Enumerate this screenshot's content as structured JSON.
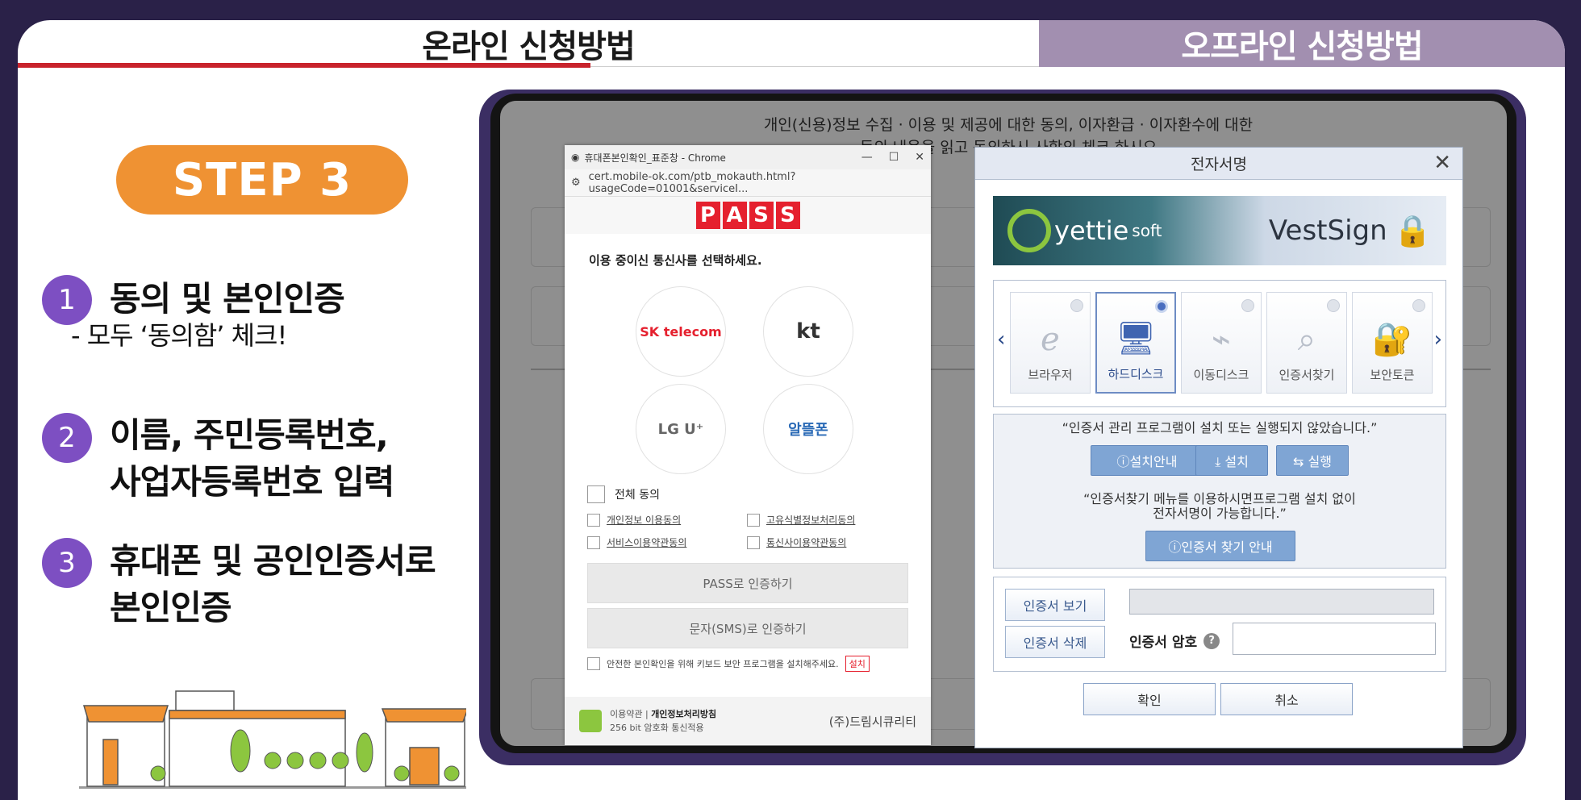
{
  "tabs": {
    "online": "온라인 신청방법",
    "offline": "오프라인 신청방법"
  },
  "step": {
    "label": "STEP 3"
  },
  "items": [
    {
      "num": "1",
      "title_line1": "동의 및 본인인증",
      "sub": "- 모두 ‘동의함’ 체크!"
    },
    {
      "num": "2",
      "title_line1": "이름, 주민등록번호,",
      "title_line2": "사업자등록번호 입력"
    },
    {
      "num": "3",
      "title_line1": "휴대폰 및 공인인증서로",
      "title_line2": "본인인증"
    }
  ],
  "background_page": {
    "line1": "개인(신용)정보 수집 · 이용 및 제공에 대한 동의, 이자환급 · 이자환수에 대한",
    "line2": "동의 내용을 읽고 동의하시 사항의 체크 하시오"
  },
  "pass_window": {
    "window_title": "휴대폰본인확인_표준창 - Chrome",
    "url": "cert.mobile-ok.com/ptb_mokauth.html?usageCode=01001&serviceI...",
    "logo_letters": [
      "P",
      "A",
      "S",
      "S"
    ],
    "prompt": "이용 중이신 통신사를 선택하세요.",
    "carriers": [
      "SK telecom",
      "kt",
      "LG U⁺",
      "알뜰폰"
    ],
    "agree_all": "전체 동의",
    "agreements": [
      "개인정보 이용동의",
      "고유식별정보처리동의",
      "서비스이용약관동의",
      "통신사이용약관동의"
    ],
    "btn_pass": "PASS로 인증하기",
    "btn_sms": "문자(SMS)로 인증하기",
    "security_note": "안전한 본인확인을 위해 키보드 보안 프로그램을 설치해주세요.",
    "install": "설치",
    "footer_terms": "이용약관",
    "footer_privacy": "개인정보처리방침",
    "footer_ssl": "256 bit 암호화 통신적용",
    "company": "(주)드림시큐리티"
  },
  "vest_dialog": {
    "title": "전자서명",
    "brand_left": "yettie",
    "brand_left_sub": "soft",
    "brand_right": "VestSign",
    "media": [
      "브라우저",
      "하드디스크",
      "이동디스크",
      "인증서찾기",
      "보안토큰"
    ],
    "notice1": "“인증서 관리 프로그램이 설치 또는 실행되지 않았습니다.”",
    "btn_install_guide": "ⓘ설치안내",
    "btn_install": "⤓ 설치",
    "btn_run": "⇆ 실행",
    "notice2_line1": "“인증서찾기 메뉴를 이용하시면프로그램 설치 없이",
    "notice2_line2": "전자서명이 가능합니다.”",
    "btn_find_guide": "ⓘ인증서 찾기 안내",
    "btn_view_cert": "인증서 보기",
    "btn_delete_cert": "인증서 삭제",
    "pw_label": "인증서 암호",
    "ok": "확인",
    "cancel": "취소"
  },
  "colors": {
    "accent_red": "#c8232c",
    "step_orange": "#ef9233",
    "num_purple": "#7d4fc2",
    "offline_tab": "#a28fb0",
    "frame": "#2a2148"
  }
}
